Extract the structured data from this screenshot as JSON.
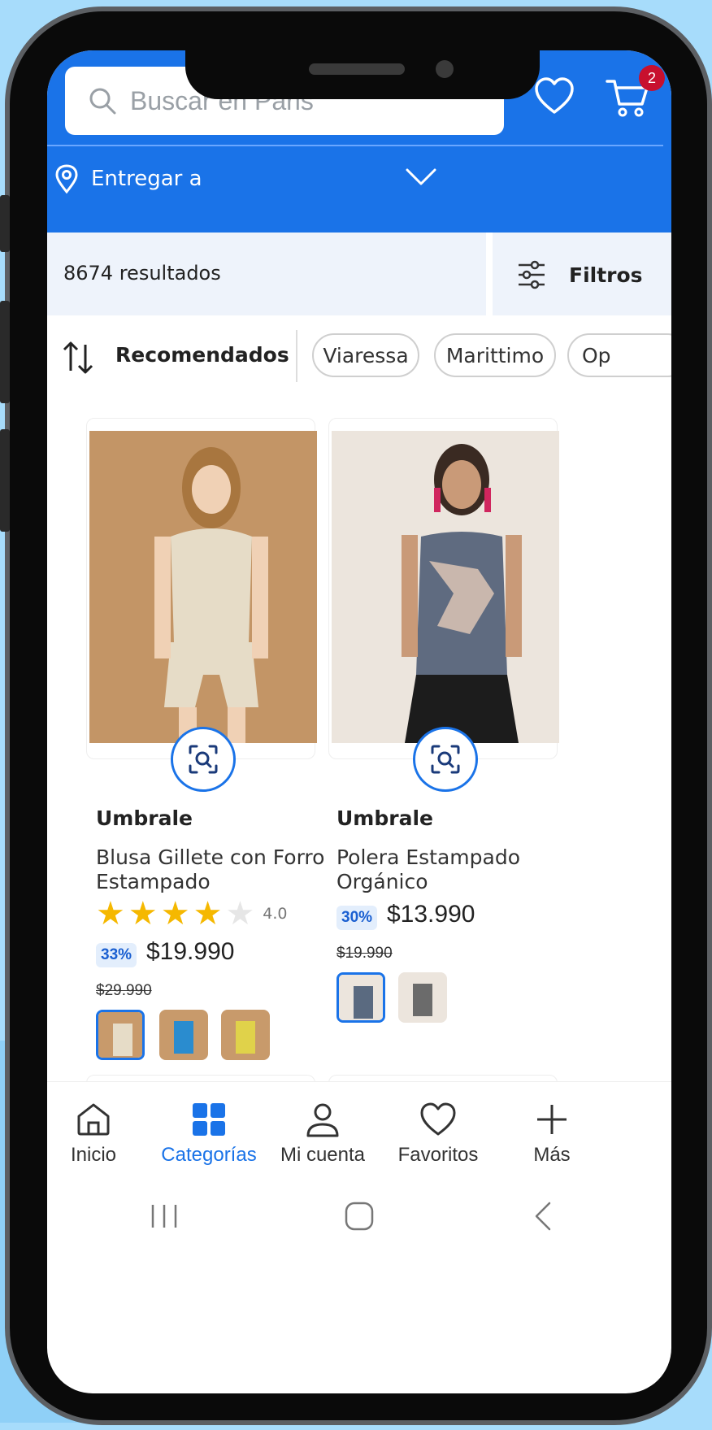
{
  "header": {
    "search_placeholder": "Buscar en Paris",
    "cart_count": "2",
    "deliver_label": "Entregar a"
  },
  "results": {
    "count_text": "8674 resultados",
    "filters_label": "Filtros"
  },
  "sort": {
    "label": "Recomendados",
    "chips": [
      "Viaressa",
      "Marittimo",
      "Op"
    ]
  },
  "products": [
    {
      "brand": "Umbrale",
      "name_line1": "Blusa Gillete con Forro",
      "name_line2": "Estampado",
      "rating": "4.0",
      "stars_filled": 4,
      "discount": "33%",
      "price": "$19.990",
      "old_price": "$29.990",
      "swatch_colors": [
        "#d7c3a8",
        "#2a8ccf",
        "#e0d24a"
      ]
    },
    {
      "brand": "Umbrale",
      "name_line1": "Polera Estampado",
      "name_line2": "Orgánico",
      "discount": "30%",
      "price": "$13.990",
      "old_price": "$19.990",
      "swatch_colors": [
        "#5a6a80",
        "#6b6b6b"
      ]
    }
  ],
  "nav": {
    "items": [
      {
        "label": "Inicio"
      },
      {
        "label": "Categorías"
      },
      {
        "label": "Mi cuenta"
      },
      {
        "label": "Favoritos"
      },
      {
        "label": "Más"
      }
    ]
  },
  "colors": {
    "brand_blue": "#1a73e8",
    "badge_red": "#c8102e",
    "star_yellow": "#f5b800"
  }
}
